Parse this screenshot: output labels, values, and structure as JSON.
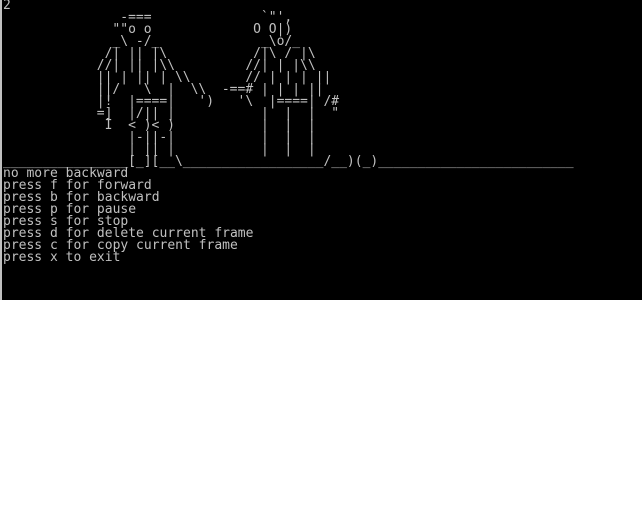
{
  "console": {
    "frame_counter": "2",
    "ascii_frame": "               -===              `\"',\n              \"\"o o             O O|)\n              _\\ -/_             _\\o/_\n             /| || |\\           /|\\ / |\\\n            //| || |\\\\         //| | |\\\\\n            || | || | \\\\       // | | | ||\n            ||/   \\  |  \\\\  -==# | | | ||\n            |!  |====|   ')   '\\  |====| /#\n            =]  |/|| |           |  |  |  \"\n             I  < )< )           |  |  |\n                |-||-|           |  |  |\n                | || |           |  |  |\n________________[_][__\\__________________/__)(_)_________________________",
    "status_line": "no more backward",
    "help": [
      "press f for forward",
      "press b for backward",
      "press p for pause",
      "press s for stop",
      "press d for delete current frame",
      "press c for copy current frame",
      "press x to exit"
    ]
  }
}
